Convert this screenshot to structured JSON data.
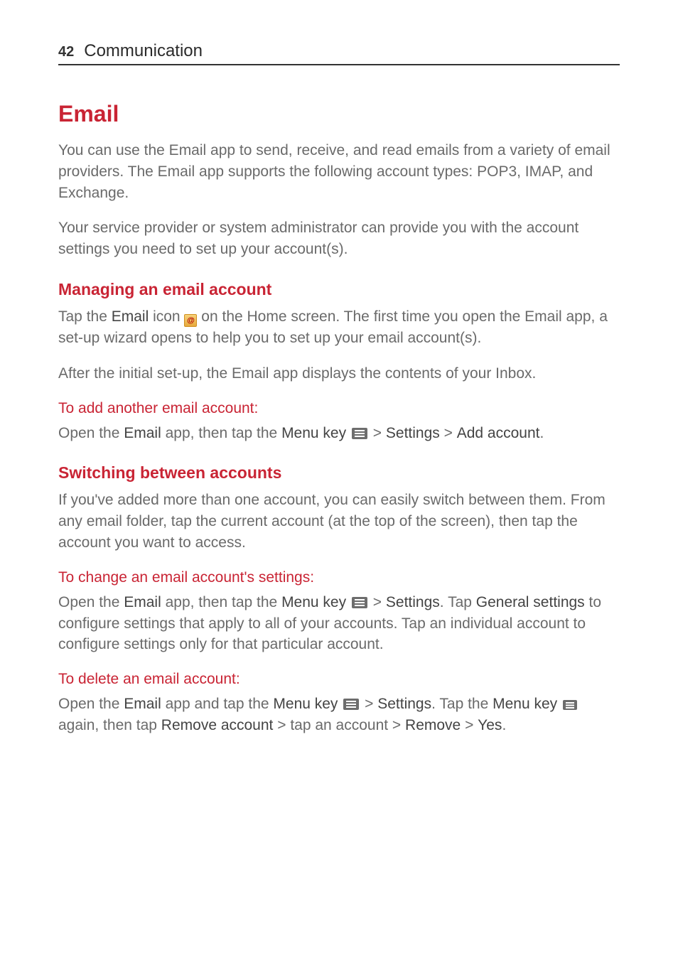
{
  "header": {
    "page_num": "42",
    "chapter": "Communication"
  },
  "title": "Email",
  "intro_p1": "You can use the Email app to send, receive, and read emails from a variety of email providers. The Email app supports the following account types: POP3, IMAP, and Exchange.",
  "intro_p2": "Your service provider or system administrator can provide you with the account settings you need to set up your account(s).",
  "managing": {
    "heading": "Managing an email account",
    "p1_a": "Tap the ",
    "p1_email": "Email",
    "p1_b": " icon ",
    "p1_c": " on the Home screen. The first time you open the Email app, a set-up wizard opens to help you to set up your email account(s).",
    "p2": "After the initial set-up, the Email app displays the contents of your Inbox."
  },
  "add": {
    "heading": "To add another email account:",
    "p_a": "Open the ",
    "p_email": "Email",
    "p_b": " app, then tap the ",
    "p_menukey": "Menu key",
    "p_c": " ",
    "p_d": " > ",
    "p_settings": "Settings",
    "p_e": " > ",
    "p_addacct": "Add account",
    "p_f": "."
  },
  "switching": {
    "heading": "Switching between accounts",
    "p1": "If you've added more than one account, you can easily switch between them. From any email folder, tap the current account (at the top of the screen), then tap the account you want to access."
  },
  "change": {
    "heading": "To change an email account's settings:",
    "p_a": "Open the ",
    "p_email": "Email",
    "p_b": " app, then tap the ",
    "p_menukey": "Menu key",
    "p_c": " ",
    "p_d": " > ",
    "p_settings": "Settings",
    "p_e": ". Tap ",
    "p_gensettings": "General settings",
    "p_f": " to configure settings that apply to all of your accounts. Tap an individual account to configure settings only for that particular account."
  },
  "delete": {
    "heading": "To delete an email account:",
    "p_a": "Open the ",
    "p_email": "Email",
    "p_b": " app and tap the ",
    "p_menukey": "Menu key",
    "p_c": " ",
    "p_d": " > ",
    "p_settings": "Settings",
    "p_e": ". Tap the ",
    "p_menukey2": "Menu key",
    "p_f": " ",
    "p_g": " again, then tap ",
    "p_removeacct": "Remove account",
    "p_h": " > tap an account > ",
    "p_remove": "Remove",
    "p_i": " > ",
    "p_yes": "Yes",
    "p_j": "."
  }
}
